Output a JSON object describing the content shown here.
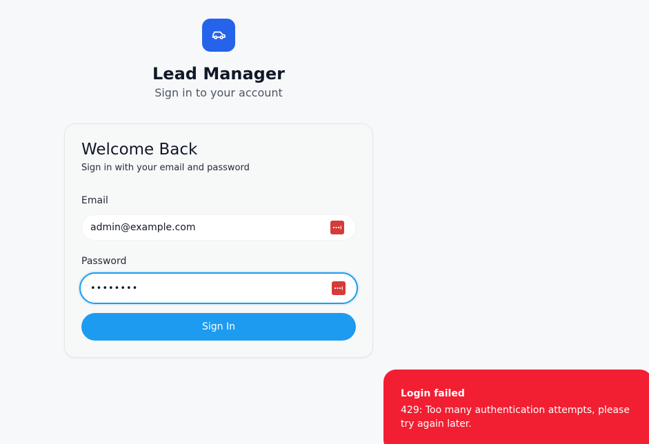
{
  "brand": {
    "app_name": "Lead Manager",
    "tagline": "Sign in to your account",
    "logo_icon": "car-icon",
    "accent_color": "#2563eb"
  },
  "card": {
    "title": "Welcome Back",
    "description": "Sign in with your email and password",
    "email": {
      "label": "Email",
      "value": "admin@example.com",
      "password_manager_icon": "password-manager-icon"
    },
    "password": {
      "label": "Password",
      "value": "••••••••",
      "password_manager_icon": "password-manager-icon"
    },
    "submit_label": "Sign In",
    "button_color": "#1d9bf0"
  },
  "toast": {
    "title": "Login failed",
    "message": "429: Too many authentication attempts, please try again later.",
    "color": "#f21f32"
  }
}
